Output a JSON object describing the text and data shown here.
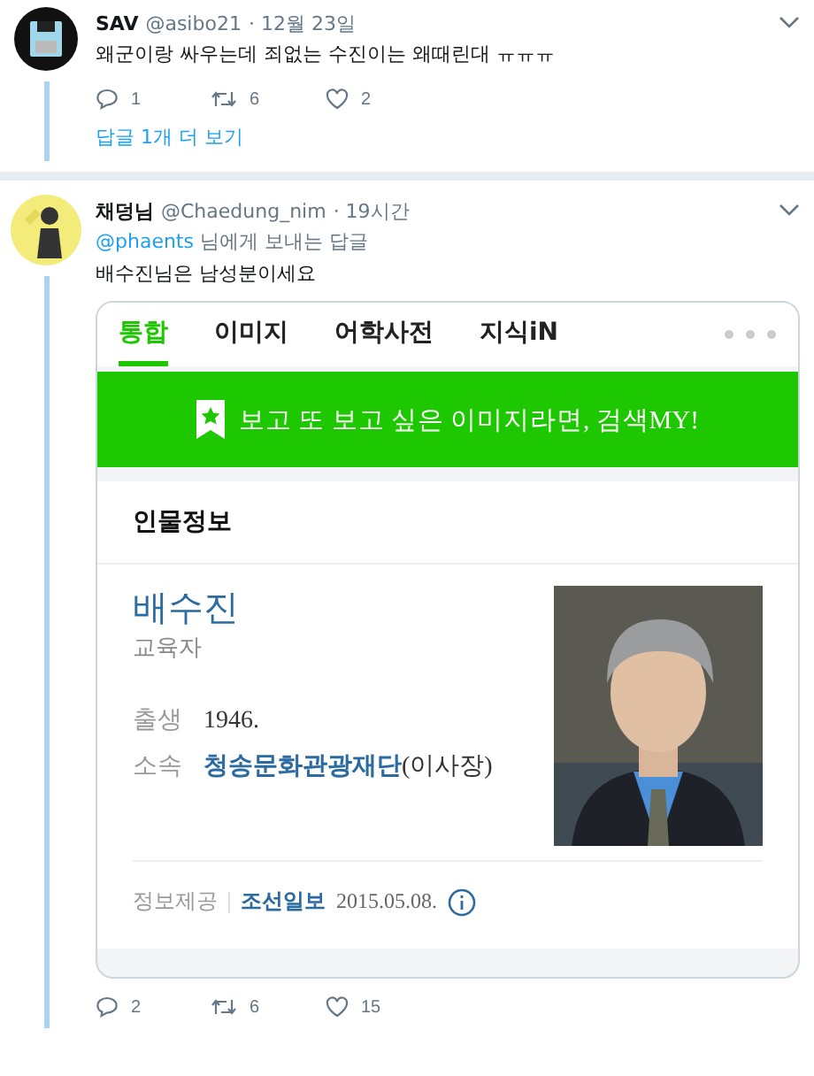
{
  "tweets": [
    {
      "name": "SAV",
      "handle": "@asibo21",
      "time": "· 12월 23일",
      "avatar": {
        "kind": "floppy"
      },
      "text": "왜군이랑 싸우는데 죄없는 수진이는 왜때린대 ㅠㅠㅠ",
      "actions": [
        {
          "kind": "reply",
          "count": "1"
        },
        {
          "kind": "retweet",
          "count": "6"
        },
        {
          "kind": "like",
          "count": "2"
        }
      ],
      "more_replies": "답글 1개 더 보기"
    },
    {
      "name": "채덩님",
      "handle": "@Chaedung_nim",
      "time": "· 19시간",
      "avatar": {
        "kind": "figure"
      },
      "reply_to": {
        "mention": "@phaents",
        "rest": "님에게 보내는 답글"
      },
      "text": "배수진님은 남성분이세요",
      "actions": [
        {
          "kind": "reply",
          "count": "2"
        },
        {
          "kind": "retweet",
          "count": "6"
        },
        {
          "kind": "like",
          "count": "15"
        }
      ],
      "card": {
        "tabs": [
          {
            "label": "통합",
            "selected": true
          },
          {
            "label": "이미지",
            "selected": false
          },
          {
            "label": "어학사전",
            "selected": false
          },
          {
            "label": "지식iN",
            "selected": false
          }
        ],
        "banner": "보고 또 보고 싶은 이미지라면, 검색MY!",
        "section_title": "인물정보",
        "person": {
          "name": "배수진",
          "job": "교육자",
          "facts": [
            {
              "label": "출생",
              "value": "1946.",
              "link": false
            },
            {
              "label": "소속",
              "value": "청송문화관광재단",
              "suffix": "(이사장)",
              "link": true
            }
          ]
        },
        "source": {
          "label": "정보제공",
          "provider": "조선일보",
          "date": "2015.05.08."
        }
      }
    }
  ]
}
